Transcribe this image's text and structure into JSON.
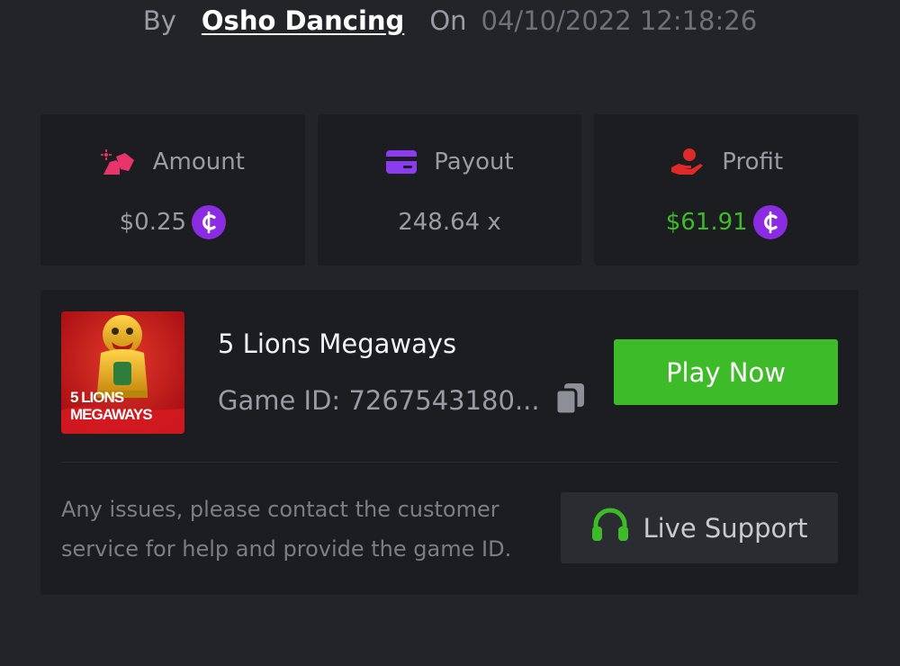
{
  "byline": {
    "by_label": "By",
    "author": "Osho Dancing",
    "on_label": "On",
    "datetime": "04/10/2022 12:18:26"
  },
  "stats": {
    "amount": {
      "label": "Amount",
      "value": "$0.25",
      "icon": "bet-amount-icon",
      "icon_color": "#e8336b"
    },
    "payout": {
      "label": "Payout",
      "value": "248.64 x",
      "icon": "card-icon",
      "icon_color": "#8b3cf0"
    },
    "profit": {
      "label": "Profit",
      "value": "$61.91",
      "icon": "hand-profit-icon",
      "icon_color": "#e02a2a",
      "value_color": "#3dbb29"
    }
  },
  "coin": {
    "symbol": "₵",
    "color": "#8b2be2"
  },
  "game": {
    "title": "5 Lions Megaways",
    "id_label": "Game ID:",
    "id_value": "7267543180...",
    "thumbnail_text_line1": "5 LIONS",
    "thumbnail_text_line2": "MEGAWAYS",
    "play_label": "Play Now",
    "play_color": "#3dbb29"
  },
  "support": {
    "help_text": "Any issues, please contact the customer service for help and provide the game ID.",
    "button_label": "Live Support",
    "icon": "headset-icon",
    "icon_color": "#3dbb29"
  }
}
